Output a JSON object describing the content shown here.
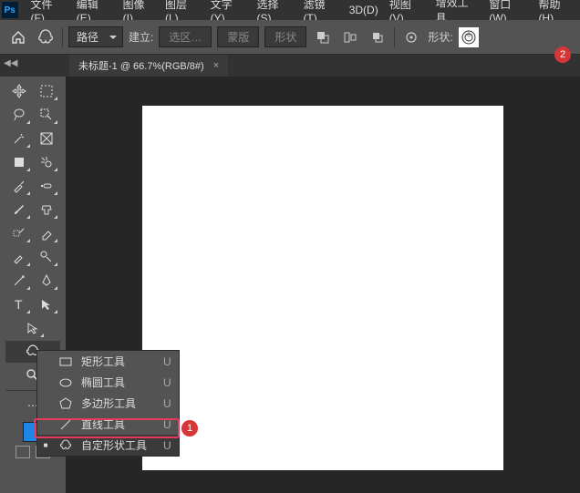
{
  "menubar": {
    "items": [
      "文件(F)",
      "编辑(E)",
      "图像(I)",
      "图层(L)",
      "文字(Y)",
      "选择(S)",
      "滤镜(T)",
      "3D(D)",
      "视图(V)",
      "增效工具",
      "窗口(W)",
      "帮助(H)"
    ]
  },
  "optionbar": {
    "mode": "路径",
    "build_label": "建立:",
    "selection": "选区…",
    "mask": "蒙版",
    "shape": "形状",
    "shape_label": "形状:"
  },
  "tabs": {
    "doc": "未标题-1 @ 66.7%(RGB/8#)"
  },
  "flyout": {
    "items": [
      {
        "label": "矩形工具",
        "key": "U"
      },
      {
        "label": "椭圆工具",
        "key": "U"
      },
      {
        "label": "多边形工具",
        "key": "U"
      },
      {
        "label": "直线工具",
        "key": "U"
      },
      {
        "label": "自定形状工具",
        "key": "U"
      }
    ]
  },
  "callouts": {
    "one": "1",
    "two": "2"
  }
}
